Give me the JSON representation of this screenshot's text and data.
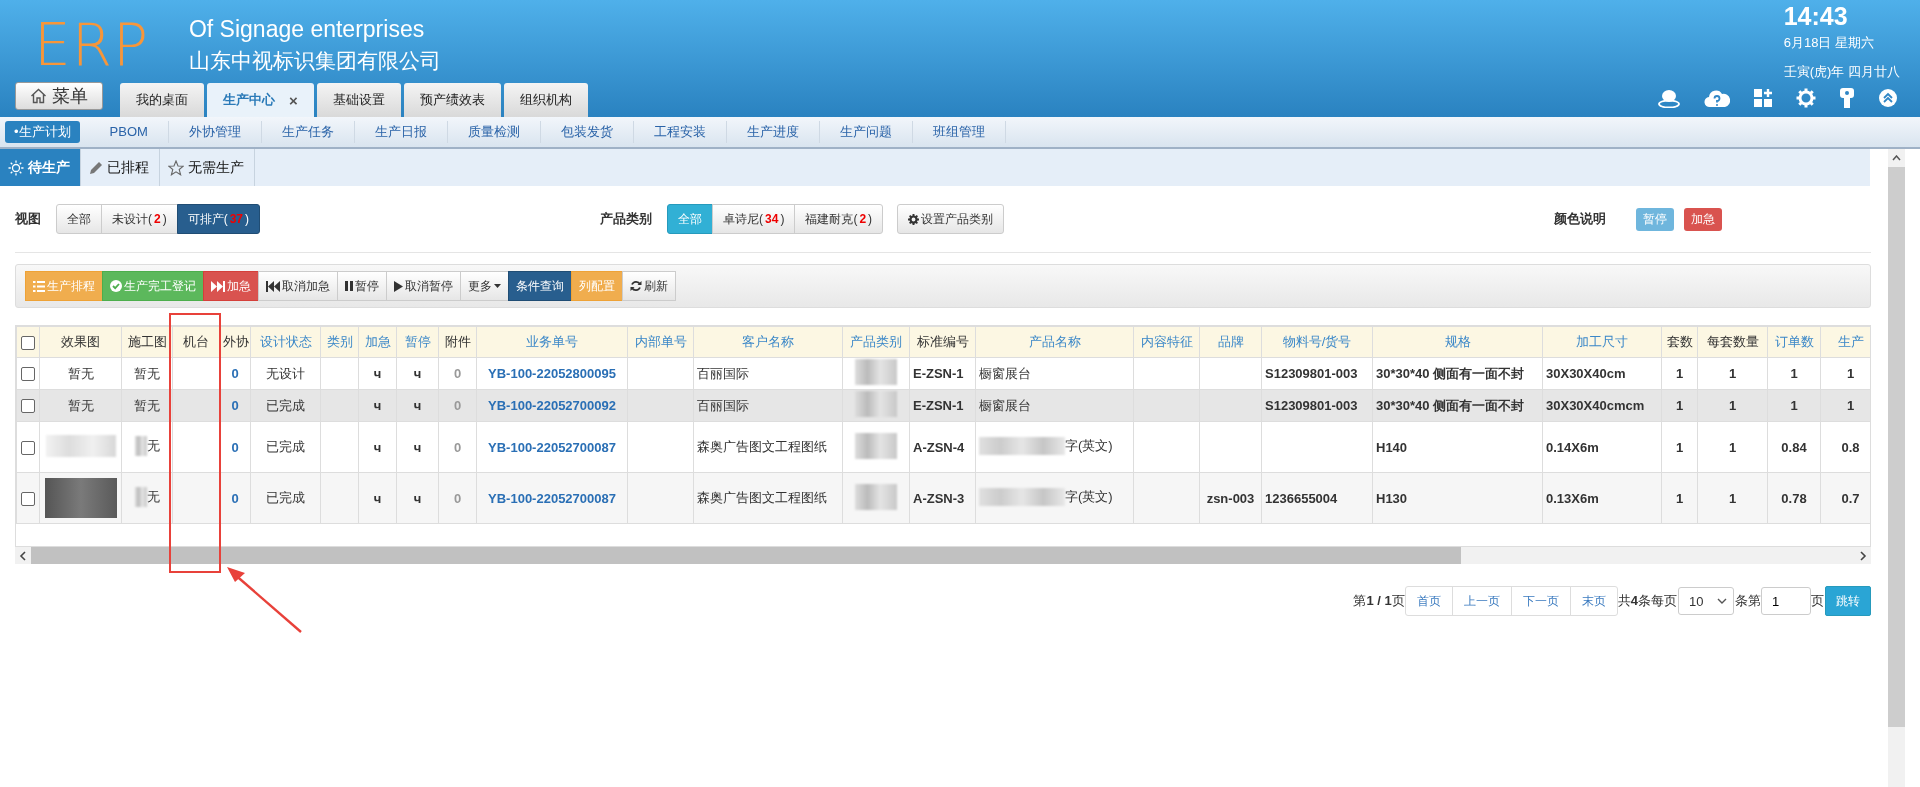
{
  "header": {
    "logo": "ERP",
    "title_en": "Of Signage enterprises",
    "title_cn": "山东中视标识集团有限公司",
    "time": "14:43",
    "date": "6月18日 星期六",
    "lunar": "壬寅(虎)年 四月廿八"
  },
  "menu_button": "菜单",
  "app_tabs": [
    {
      "label": "我的桌面",
      "selected": false
    },
    {
      "label": "生产中心",
      "selected": true,
      "close": "×"
    },
    {
      "label": "基础设置",
      "selected": false
    },
    {
      "label": "预产绩效表",
      "selected": false
    },
    {
      "label": "组织机构",
      "selected": false
    }
  ],
  "modules": [
    {
      "label": "•生产计划",
      "selected": true
    },
    {
      "label": "PBOM",
      "selected": false
    },
    {
      "label": "外协管理",
      "selected": false
    },
    {
      "label": "生产任务",
      "selected": false
    },
    {
      "label": "生产日报",
      "selected": false
    },
    {
      "label": "质量检测",
      "selected": false
    },
    {
      "label": "包装发货",
      "selected": false
    },
    {
      "label": "工程安装",
      "selected": false
    },
    {
      "label": "生产进度",
      "selected": false
    },
    {
      "label": "生产问题",
      "selected": false
    },
    {
      "label": "班组管理",
      "selected": false
    }
  ],
  "subtabs": [
    {
      "label": "待生产",
      "selected": true
    },
    {
      "label": "已排程",
      "selected": false
    },
    {
      "label": "无需生产",
      "selected": false
    }
  ],
  "view_filter": {
    "label": "视图",
    "options": [
      {
        "label": "全部",
        "selected": false
      },
      {
        "label": "未设计(",
        "count": "2",
        "suffix": ")",
        "selected": false
      },
      {
        "label": "可排产(",
        "count": "37",
        "suffix": ")",
        "selected": true
      }
    ]
  },
  "category_filter": {
    "label": "产品类别",
    "options": [
      {
        "label": "全部",
        "selected": true
      },
      {
        "label": "卓诗尼(",
        "count": "34",
        "suffix": ")",
        "selected": false
      },
      {
        "label": "福建耐克(",
        "count": "2",
        "suffix": ")",
        "selected": false
      }
    ],
    "settings_button": "设置产品类别"
  },
  "color_legend": {
    "label": "颜色说明",
    "items": [
      {
        "label": "暂停",
        "color": "#6fb6dd"
      },
      {
        "label": "加急",
        "color": "#d9534f"
      }
    ]
  },
  "toolbar": [
    {
      "label": "生产排程",
      "kind": "warning"
    },
    {
      "label": "生产完工登记",
      "kind": "success"
    },
    {
      "label": "加急",
      "kind": "danger"
    },
    {
      "label": "取消加急",
      "kind": "default"
    },
    {
      "label": "暂停",
      "kind": "default"
    },
    {
      "label": "取消暂停",
      "kind": "default"
    },
    {
      "label": "更多",
      "kind": "default"
    },
    {
      "label": "条件查询",
      "kind": "primary"
    },
    {
      "label": "列配置",
      "kind": "warning"
    },
    {
      "label": "刷新",
      "kind": "default"
    }
  ],
  "table": {
    "select_all_checked": false,
    "columns": [
      {
        "label": "效果图",
        "sortable": false,
        "kind": "plain"
      },
      {
        "label": "施工图",
        "sortable": false,
        "kind": "plain"
      },
      {
        "label": "机台",
        "sortable": false,
        "kind": "plain"
      },
      {
        "label": "外协",
        "sortable": false,
        "kind": "count"
      },
      {
        "label": "设计状态",
        "sortable": true,
        "kind": "plain"
      },
      {
        "label": "类别",
        "sortable": true,
        "kind": "plain"
      },
      {
        "label": "加急",
        "sortable": true,
        "kind": "bold"
      },
      {
        "label": "暂停",
        "sortable": true,
        "kind": "bold"
      },
      {
        "label": "附件",
        "sortable": false,
        "kind": "muted"
      },
      {
        "label": "业务单号",
        "sortable": true,
        "kind": "link"
      },
      {
        "label": "内部单号",
        "sortable": true,
        "kind": "plain"
      },
      {
        "label": "客户名称",
        "sortable": true,
        "kind": "name"
      },
      {
        "label": "产品类别",
        "sortable": true,
        "kind": "plain"
      },
      {
        "label": "标准编号",
        "sortable": false,
        "kind": "boldleft"
      },
      {
        "label": "产品名称",
        "sortable": true,
        "kind": "name"
      },
      {
        "label": "内容特征",
        "sortable": true,
        "kind": "plain"
      },
      {
        "label": "品牌",
        "sortable": true,
        "kind": "bold"
      },
      {
        "label": "物料号/货号",
        "sortable": true,
        "kind": "boldleft"
      },
      {
        "label": "规格",
        "sortable": true,
        "kind": "boldleft"
      },
      {
        "label": "加工尺寸",
        "sortable": true,
        "kind": "boldleft"
      },
      {
        "label": "套数",
        "sortable": false,
        "kind": "bold"
      },
      {
        "label": "每套数量",
        "sortable": false,
        "kind": "bold"
      },
      {
        "label": "订单数",
        "sortable": true,
        "kind": "bold"
      },
      {
        "label": "生产",
        "sortable": true,
        "kind": "bold"
      }
    ],
    "rows": [
      {
        "checked": false,
        "highlighted": false,
        "cells": [
          "暂无",
          "暂无",
          null,
          "0",
          "无设计",
          null,
          "ч",
          "ч",
          "0",
          "YB-100-22052800095",
          null,
          "百丽国际",
          {
            "kind": "blurred"
          },
          "E-ZSN-1",
          "橱窗展台",
          null,
          null,
          "S12309801-003",
          "30*30*40 侧面有一面不封",
          "30X30X40cm",
          "1",
          "1",
          "1",
          "1"
        ]
      },
      {
        "checked": false,
        "highlighted": true,
        "cells": [
          "暂无",
          "暂无",
          null,
          "0",
          "已完成",
          null,
          "ч",
          "ч",
          "0",
          "YB-100-22052700092",
          null,
          "百丽国际",
          {
            "kind": "blurred"
          },
          "E-ZSN-1",
          "橱窗展台",
          null,
          null,
          "S12309801-003",
          "30*30*40 侧面有一面不封",
          "30X30X40cmcm",
          "1",
          "1",
          "1",
          "1"
        ]
      },
      {
        "checked": false,
        "highlighted": false,
        "cells": [
          {
            "kind": "blurred"
          },
          {
            "kind": "blurred",
            "text": "无"
          },
          null,
          "0",
          "已完成",
          null,
          "ч",
          "ч",
          "0",
          "YB-100-22052700087",
          null,
          "森奥广告图文工程图纸",
          {
            "kind": "blurred"
          },
          "A-ZSN-4",
          {
            "kind": "blurred",
            "text": "字(英文)"
          },
          null,
          null,
          null,
          "H140",
          "0.14X6m",
          "1",
          "1",
          "0.84",
          "0.8"
        ]
      },
      {
        "checked": false,
        "highlighted": false,
        "cells": [
          {
            "kind": "photo"
          },
          {
            "kind": "blurred",
            "text": "无"
          },
          null,
          "0",
          "已完成",
          null,
          "ч",
          "ч",
          "0",
          "YB-100-22052700087",
          null,
          "森奥广告图文工程图纸",
          {
            "kind": "blurred"
          },
          "A-ZSN-3",
          {
            "kind": "blurred",
            "text": "字(英文)"
          },
          null,
          "zsn-003",
          "1236655004",
          "H130",
          "0.13X6m",
          "1",
          "1",
          "0.78",
          "0.7"
        ]
      }
    ]
  },
  "pagination": {
    "page_info": "第**1 / 1**页",
    "buttons": [
      "首页",
      "上一页",
      "下一页",
      "末页"
    ],
    "total": "共**4**条每页",
    "page_size": "10",
    "page_prefix": "条第",
    "page_input": "1",
    "page_suffix": "页",
    "go_button": "跳转"
  }
}
